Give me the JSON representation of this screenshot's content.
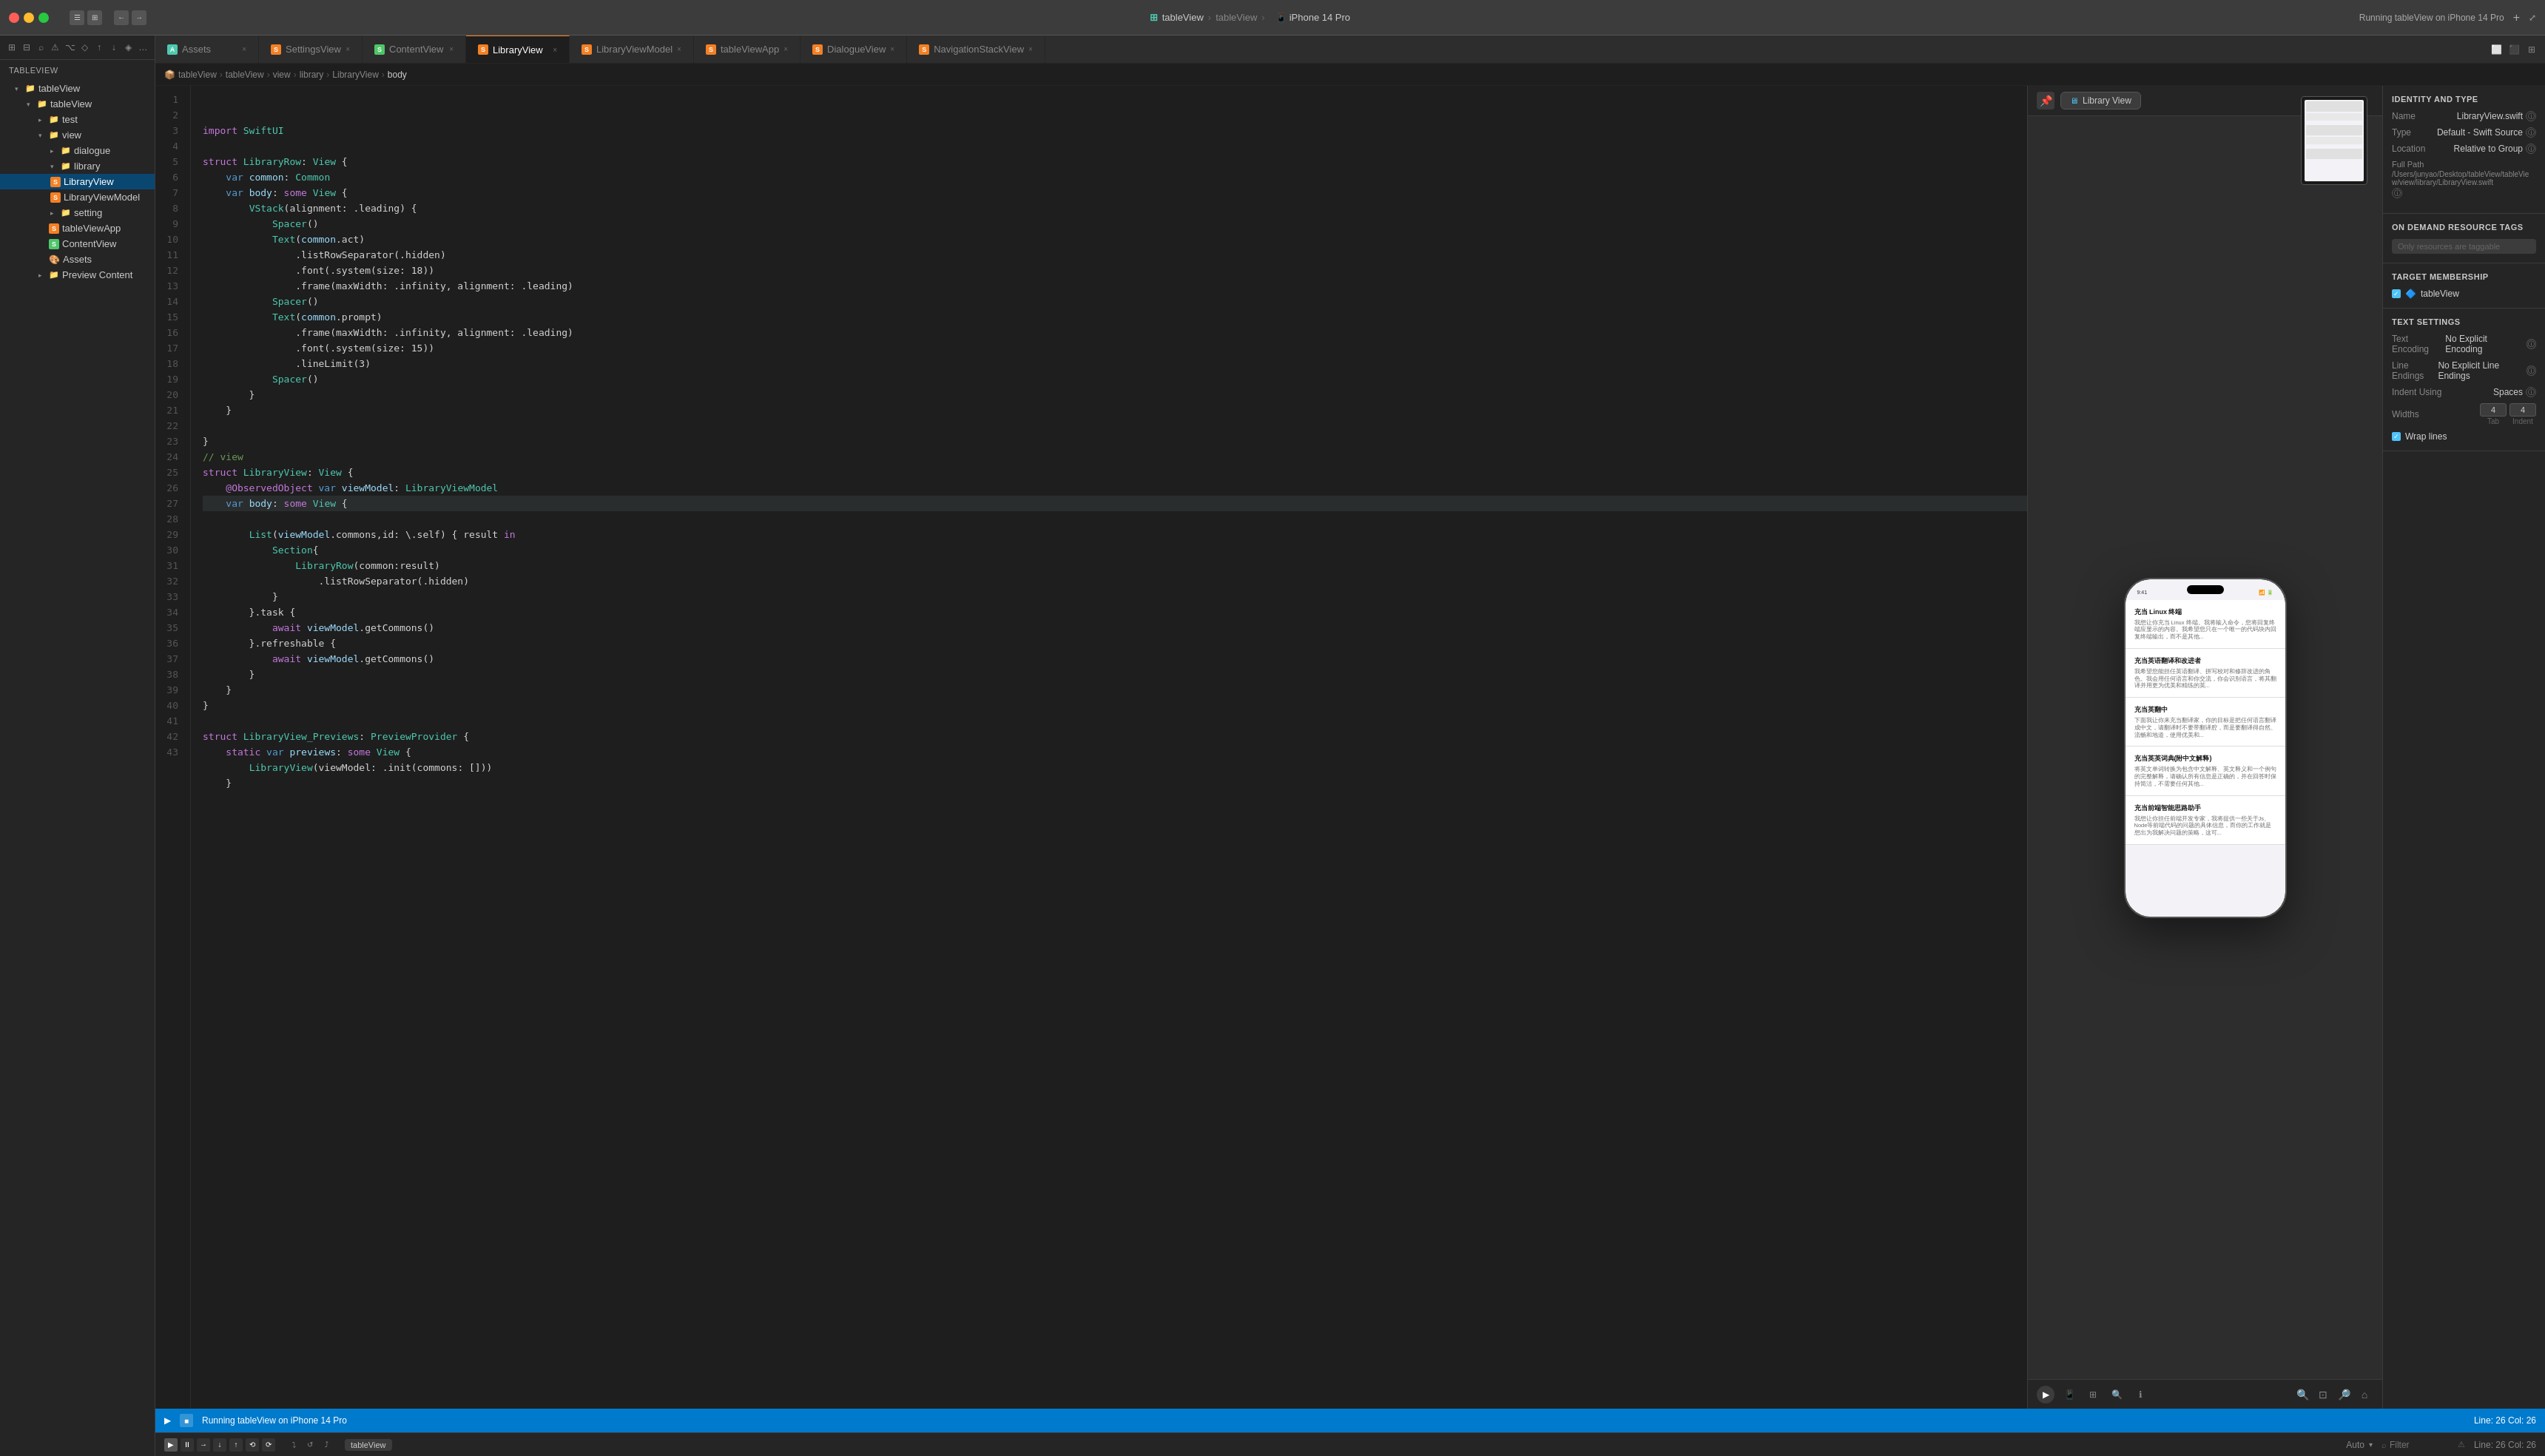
{
  "titleBar": {
    "appName": "tableView",
    "deviceLabel": "iPhone 14 Pro",
    "runningLabel": "Running tableView on iPhone 14 Pro",
    "addIcon": "+",
    "fullscreenIcon": "⤢"
  },
  "tabs": [
    {
      "id": "assets",
      "label": "Assets",
      "color": "#4ec9b0"
    },
    {
      "id": "settingsview",
      "label": "SettingsView",
      "color": "#f48024"
    },
    {
      "id": "contentview",
      "label": "ContentView",
      "color": "#f48024"
    },
    {
      "id": "libraryview",
      "label": "LibraryView",
      "color": "#f48024",
      "active": true
    },
    {
      "id": "libraryviewmodel",
      "label": "LibraryViewModel",
      "color": "#f48024"
    },
    {
      "id": "tableviewapp",
      "label": "tableViewApp",
      "color": "#f48024"
    },
    {
      "id": "dialogueview",
      "label": "DialogueView",
      "color": "#f48024"
    },
    {
      "id": "navigationstackview",
      "label": "NavigationStackView",
      "color": "#f48024"
    }
  ],
  "breadcrumb": {
    "items": [
      "tableView",
      "tableView",
      "view",
      "library",
      "LibraryView",
      "body"
    ]
  },
  "sidebar": {
    "header": "tableView",
    "items": [
      {
        "id": "tableView-root",
        "label": "tableView",
        "level": 1,
        "expanded": true,
        "type": "folder"
      },
      {
        "id": "tableView-group",
        "label": "tableView",
        "level": 2,
        "expanded": true,
        "type": "folder"
      },
      {
        "id": "test",
        "label": "test",
        "level": 3,
        "expanded": false,
        "type": "folder"
      },
      {
        "id": "view",
        "label": "view",
        "level": 3,
        "expanded": true,
        "type": "folder"
      },
      {
        "id": "dialogue",
        "label": "dialogue",
        "level": 4,
        "expanded": false,
        "type": "folder"
      },
      {
        "id": "library",
        "label": "library",
        "level": 4,
        "expanded": true,
        "type": "folder"
      },
      {
        "id": "LibraryView",
        "label": "LibraryView",
        "level": 5,
        "type": "swift",
        "color": "orange",
        "active": true
      },
      {
        "id": "LibraryViewModel",
        "label": "LibraryViewModel",
        "level": 5,
        "type": "swift",
        "color": "orange"
      },
      {
        "id": "setting",
        "label": "setting",
        "level": 4,
        "expanded": false,
        "type": "folder"
      },
      {
        "id": "tableViewApp",
        "label": "tableViewApp",
        "level": 3,
        "type": "swift",
        "color": "orange"
      },
      {
        "id": "ContentView",
        "label": "ContentView",
        "level": 3,
        "type": "swift",
        "color": "green"
      },
      {
        "id": "Assets",
        "label": "Assets",
        "level": 3,
        "type": "assets"
      },
      {
        "id": "PreviewContent",
        "label": "Preview Content",
        "level": 3,
        "type": "folder"
      }
    ]
  },
  "editor": {
    "filename": "LibraryView.swift",
    "currentLine": 26,
    "currentCol": 26,
    "lines": [
      {
        "num": 1,
        "code": ""
      },
      {
        "num": 2,
        "code": "import SwiftUI"
      },
      {
        "num": 3,
        "code": ""
      },
      {
        "num": 4,
        "code": "struct LibraryRow: View {"
      },
      {
        "num": 5,
        "code": "    var common: Common"
      },
      {
        "num": 6,
        "code": "    var body: some View {"
      },
      {
        "num": 7,
        "code": "        VStack(alignment: .leading) {"
      },
      {
        "num": 8,
        "code": "            Spacer()"
      },
      {
        "num": 9,
        "code": "            Text(common.act)"
      },
      {
        "num": 10,
        "code": "                .listRowSeparator(.hidden)"
      },
      {
        "num": 11,
        "code": "                .font(.system(size: 18))"
      },
      {
        "num": 12,
        "code": "                .frame(maxWidth: .infinity, alignment: .leading)"
      },
      {
        "num": 13,
        "code": "            Spacer()"
      },
      {
        "num": 14,
        "code": "            Text(common.prompt)"
      },
      {
        "num": 15,
        "code": "                .frame(maxWidth: .infinity, alignment: .leading)"
      },
      {
        "num": 16,
        "code": "                .font(.system(size: 15))"
      },
      {
        "num": 17,
        "code": "                .lineLimit(3)"
      },
      {
        "num": 18,
        "code": "            Spacer()"
      },
      {
        "num": 19,
        "code": "        }"
      },
      {
        "num": 20,
        "code": "    }"
      },
      {
        "num": 21,
        "code": ""
      },
      {
        "num": 22,
        "code": "}"
      },
      {
        "num": 23,
        "code": "// view"
      },
      {
        "num": 24,
        "code": "struct LibraryView: View {"
      },
      {
        "num": 25,
        "code": "    @ObservedObject var viewModel: LibraryViewModel"
      },
      {
        "num": 26,
        "code": "    var body: some View {",
        "current": true
      },
      {
        "num": 27,
        "code": "        List(viewModel.commons,id: \\.self) { result in"
      },
      {
        "num": 28,
        "code": "            Section{"
      },
      {
        "num": 29,
        "code": "                LibraryRow(common:result)"
      },
      {
        "num": 30,
        "code": "                    .listRowSeparator(.hidden)"
      },
      {
        "num": 31,
        "code": "            }"
      },
      {
        "num": 32,
        "code": "        }.task {"
      },
      {
        "num": 33,
        "code": "            await viewModel.getCommons()"
      },
      {
        "num": 34,
        "code": "        }.refreshable {"
      },
      {
        "num": 35,
        "code": "            await viewModel.getCommons()"
      },
      {
        "num": 36,
        "code": "        }"
      },
      {
        "num": 37,
        "code": "    }"
      },
      {
        "num": 38,
        "code": "}"
      },
      {
        "num": 39,
        "code": ""
      },
      {
        "num": 40,
        "code": "struct LibraryView_Previews: PreviewProvider {"
      },
      {
        "num": 41,
        "code": "    static var previews: some View {"
      },
      {
        "num": 42,
        "code": "        LibraryView(viewModel: .init(commons: []))"
      },
      {
        "num": 43,
        "code": "    }"
      }
    ]
  },
  "preview": {
    "deviceName": "iPhone 14 Pro",
    "libraryViewLabel": "Library View",
    "listItems": [
      {
        "title": "充当 Linux 终端",
        "desc": "我想让你充当 Linux 终端。我将输入命令，您将回复终端应显示的内容。我希望您只在一个唯一的代码块内回复终端输出，而不是其他..."
      },
      {
        "title": "充当英语翻译和改进者",
        "desc": "我希望您能担任英语翻译、拼写校对和修辞改进的角色。我会用任何语言和你交流，你会识别语言，将其翻译并用更为优美和精练的英..."
      },
      {
        "title": "充当英翻中",
        "desc": "下面我让你来充当翻译家，你的目标是把任何语言翻译成中文，请翻译时不要带翻译腔，而是要翻译得自然、流畅和地道，使用优美和..."
      },
      {
        "title": "充当英英词典(附中文解释)",
        "desc": "将英文单词转换为包含中文解释、英文释义和一个例句的完整解释，请确认所有信息是正确的，并在回答时保持简洁，不需要任何其他..."
      },
      {
        "title": "充当前端智能思路助手",
        "desc": "我想让你担任前端开发专家，我将提供一些关于Js、Node等前端代码的问题的具体信息，而你的工作就是想出为我解决问题的策略，这可..."
      }
    ]
  },
  "rightPanel": {
    "identityType": {
      "title": "Identity and Type",
      "nameLabel": "Name",
      "nameValue": "LibraryView.swift",
      "typeLabel": "Type",
      "typeValue": "Default - Swift Source",
      "locationLabel": "Location",
      "locationValue": "Relative to Group",
      "fullPathLabel": "Full Path",
      "fullPathValue": "/Users/junyao/Desktop/tableView/tableView/view/library/LibraryView.swift"
    },
    "onDemand": {
      "title": "On Demand Resource Tags",
      "placeholder": "Only resources are taggable"
    },
    "targetMembership": {
      "title": "Target Membership",
      "item": "tableView"
    },
    "textSettings": {
      "title": "Text Settings",
      "encodingLabel": "Text Encoding",
      "encodingValue": "No Explicit Encoding",
      "lineEndingsLabel": "Line Endings",
      "lineEndingsValue": "No Explicit Line Endings",
      "indentUsingLabel": "Indent Using",
      "indentUsingValue": "Spaces",
      "widthsLabel": "Widths",
      "tabWidth": "4",
      "indentWidth": "4",
      "tabLabel": "Tab",
      "indentLabel": "Indent",
      "wrapLinesLabel": "Wrap lines"
    }
  },
  "statusBar": {
    "runningLabel": "Running tableView on iPhone 14 Pro",
    "lineCol": "Line: 26  Col: 26",
    "filterLabel": "Filter",
    "autoLabel": "Auto"
  },
  "bottomBar": {
    "playIcon": "▶",
    "pauseIcon": "⏸",
    "stopIcon": "■",
    "filterPlaceholder": "Filter",
    "lineColLabel": "Line: 26  Col: 26",
    "schemeLabel": "tableView",
    "autoLabel": "Auto"
  }
}
